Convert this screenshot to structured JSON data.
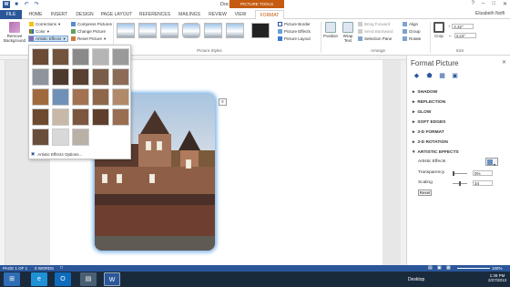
{
  "window": {
    "title": "Document1 - Word",
    "contextual_label": "PICTURE TOOLS",
    "user": "Elizabeth Nolfi"
  },
  "qat": {
    "word_icon": "word-icon",
    "save_icon": "save-icon",
    "undo_icon": "undo-icon",
    "redo_icon": "redo-icon"
  },
  "tabs": {
    "file": "FILE",
    "home": "HOME",
    "insert": "INSERT",
    "design": "DESIGN",
    "layout": "PAGE LAYOUT",
    "references": "REFERENCES",
    "mailings": "MAILINGS",
    "review": "REVIEW",
    "view": "VIEW",
    "format": "FORMAT"
  },
  "ribbon": {
    "remove_background": "Remove Background",
    "corrections": "Corrections",
    "color": "Color",
    "artistic_effects": "Artistic Effects",
    "compress": "Compress Pictures",
    "change": "Change Picture",
    "reset": "Reset Picture",
    "picture_border": "Picture Border",
    "picture_effects": "Picture Effects",
    "picture_layout": "Picture Layout",
    "styles_group": "Picture Styles",
    "position": "Position",
    "wrap_text": "Wrap Text",
    "bring_forward": "Bring Forward",
    "send_backward": "Send Backward",
    "selection_pane": "Selection Pane",
    "align": "Align",
    "group": "Group",
    "rotate": "Rotate",
    "arrange_group": "Arrange",
    "crop": "Crop",
    "height": "4.32\"",
    "width": "3.24\"",
    "size_group": "Size"
  },
  "gallery": {
    "options_label": "Artistic Effects Options..."
  },
  "pane": {
    "title": "Format Picture",
    "sections": [
      "SHADOW",
      "REFLECTION",
      "GLOW",
      "SOFT EDGES",
      "3-D FORMAT",
      "3-D ROTATION",
      "ARTISTIC EFFECTS"
    ],
    "artistic_effects_label": "Artistic Effects",
    "transparency_label": "Transparency",
    "transparency_value": "0%",
    "scaling_label": "Scaling",
    "scaling_value": "34",
    "reset_label": "Reset"
  },
  "status": {
    "page": "PAGE 1 OF 1",
    "words": "0 WORDS",
    "zoom": "100%"
  },
  "taskbar": {
    "desktop": "Desktop",
    "time": "1:39 PM",
    "date": "2/27/2013"
  },
  "colors": {
    "accent": "#2b579a",
    "context": "#c55a11"
  }
}
